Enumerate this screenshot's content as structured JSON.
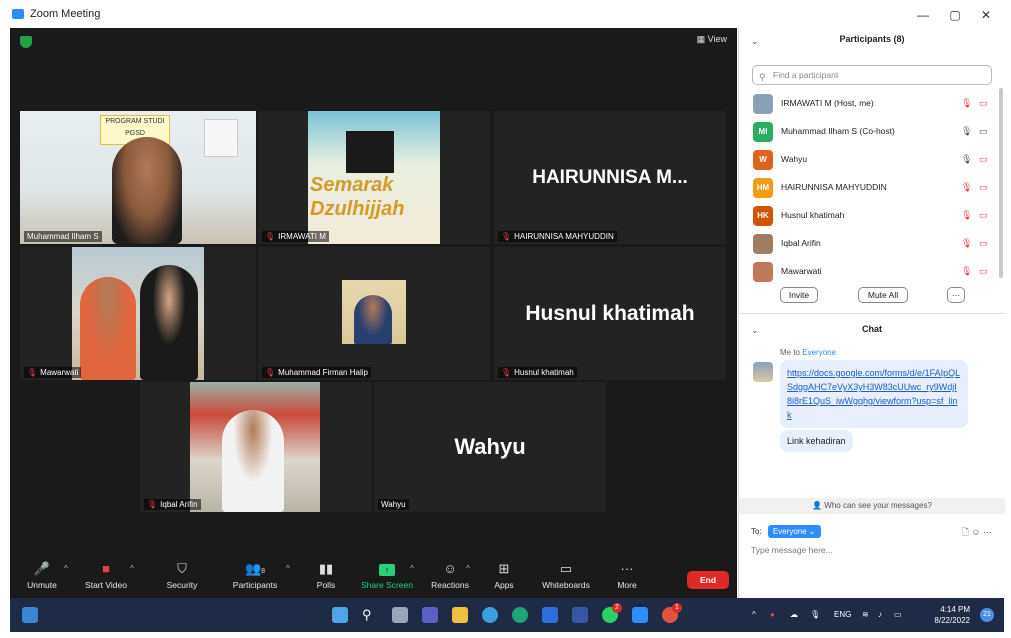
{
  "window": {
    "title": "Zoom Meeting",
    "minimize": "—",
    "maximize": "▢",
    "close": "✕"
  },
  "meeting": {
    "view_label": "View",
    "tiles": [
      {
        "name": "Muhammad Ilham S",
        "muted": false,
        "video": true,
        "big_name": "",
        "badge_text": "PROGRAM STUDI PGSD"
      },
      {
        "name": "IRMAWATI M",
        "muted": true,
        "video": true,
        "big_name": "",
        "poster_text": "Semarak Dzulhijjah"
      },
      {
        "name": "HAIRUNNISA MAHYUDDIN",
        "muted": true,
        "video": false,
        "big_name": "HAIRUNNISA M..."
      },
      {
        "name": "Mawarwati",
        "muted": true,
        "video": true,
        "big_name": ""
      },
      {
        "name": "Muhammad Firman Halip",
        "muted": true,
        "video": true,
        "big_name": ""
      },
      {
        "name": "Husnul khatimah",
        "muted": true,
        "video": false,
        "big_name": "Husnul khatimah"
      },
      {
        "name": "Iqbal Arifin",
        "muted": true,
        "video": true,
        "big_name": ""
      },
      {
        "name": "Wahyu",
        "muted": false,
        "video": false,
        "big_name": "Wahyu"
      }
    ]
  },
  "toolbar": {
    "unmute": "Unmute",
    "start_video": "Start Video",
    "security": "Security",
    "participants": "Participants",
    "participants_count": "8",
    "polls": "Polls",
    "share_screen": "Share Screen",
    "reactions": "Reactions",
    "apps": "Apps",
    "whiteboards": "Whiteboards",
    "more": "More",
    "end": "End"
  },
  "participants_panel": {
    "title": "Participants (8)",
    "search_placeholder": "Find a participant",
    "participants": [
      {
        "initials": "",
        "name": "IRMAWATI M (Host, me)",
        "color": "#8aa0b8",
        "mic_muted": true,
        "cam_off": true
      },
      {
        "initials": "MI",
        "name": "Muhammad Ilham S (Co-host)",
        "color": "#27ae60",
        "mic_muted": false,
        "cam_off": false
      },
      {
        "initials": "W",
        "name": "Wahyu",
        "color": "#e0631c",
        "mic_muted": false,
        "cam_off": true
      },
      {
        "initials": "HM",
        "name": "HAIRUNNISA MAHYUDDIN",
        "color": "#f39c12",
        "mic_muted": true,
        "cam_off": true
      },
      {
        "initials": "HK",
        "name": "Husnul khatimah",
        "color": "#d35400",
        "mic_muted": true,
        "cam_off": true
      },
      {
        "initials": "",
        "name": "Iqbal Arifin",
        "color": "#a07d62",
        "mic_muted": true,
        "cam_off": true
      },
      {
        "initials": "",
        "name": "Mawarwati",
        "color": "#c0785a",
        "mic_muted": true,
        "cam_off": true
      }
    ],
    "invite": "Invite",
    "mute_all": "Mute All",
    "more": "···"
  },
  "chat": {
    "title": "Chat",
    "meta_prefix": "Me to",
    "meta_target": "Everyone",
    "messages": [
      "https://docs.google.com/forms/d/e/1FAIpQLSdggAHC7eVyX3yH3W83cUUwc_ry9WdjI8i8rE1QuS_iwWgqhg/viewform?usp=sf_link",
      "Link kehadiran"
    ],
    "who_can_see": "Who can see your messages?",
    "to_label": "To:",
    "to_target": "Everyone ⌄",
    "input_placeholder": "Type message here..."
  },
  "taskbar": {
    "language": "ENG",
    "time": "4:14 PM",
    "date": "8/22/2022",
    "notifications": "21",
    "whatsapp_badge": "2",
    "chrome_badge": "1"
  }
}
